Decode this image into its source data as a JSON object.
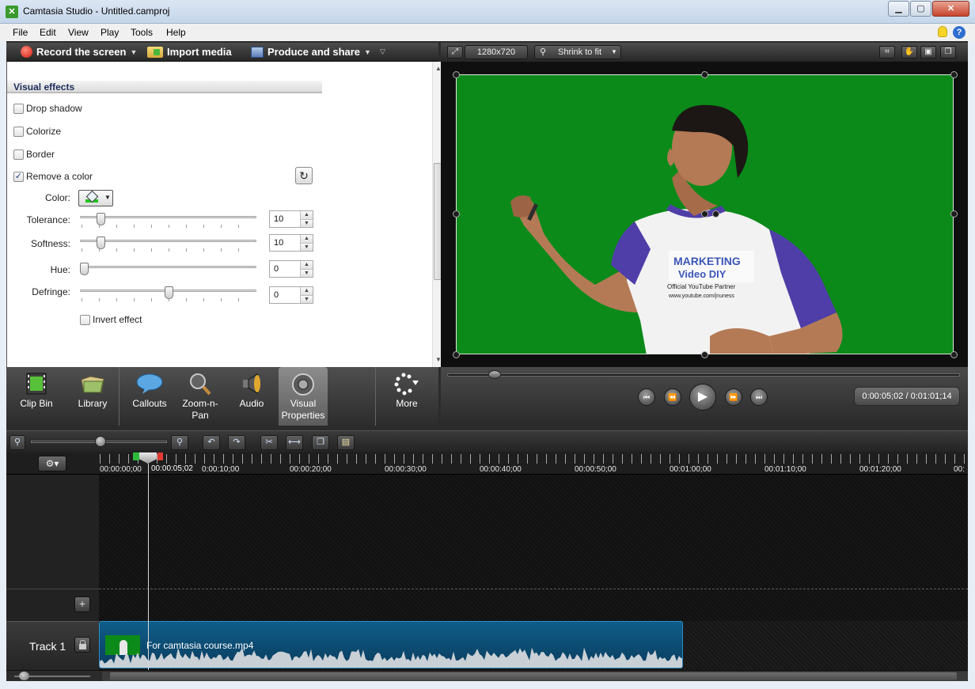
{
  "window": {
    "title": "Camtasia Studio - Untitled.camproj",
    "min_label": "▁",
    "max_label": "▢",
    "close_label": "✕"
  },
  "menu": [
    "File",
    "Edit",
    "View",
    "Play",
    "Tools",
    "Help"
  ],
  "toolbar": {
    "record_label": "Record the screen",
    "import_label": "Import media",
    "produce_label": "Produce and share"
  },
  "visual_effects": {
    "header": "Visual effects",
    "drop_shadow": "Drop shadow",
    "drop_shadow_checked": false,
    "colorize": "Colorize",
    "colorize_checked": false,
    "border": "Border",
    "border_checked": false,
    "remove_color": "Remove a color",
    "remove_color_checked": true,
    "color_label": "Color:",
    "key_color": "#1fc41f",
    "tolerance_label": "Tolerance:",
    "tolerance_value": "10",
    "softness_label": "Softness:",
    "softness_value": "10",
    "hue_label": "Hue:",
    "hue_value": "0",
    "defringe_label": "Defringe:",
    "defringe_value": "0",
    "invert_label": "Invert effect",
    "invert_checked": false
  },
  "tabs": [
    {
      "label": "Clip Bin",
      "icon": "film-strip-icon"
    },
    {
      "label": "Library",
      "icon": "library-folder-icon"
    },
    {
      "label": "Callouts",
      "icon": "speech-bubble-icon"
    },
    {
      "label": "Zoom-n-\nPan",
      "icon": "magnifier-icon"
    },
    {
      "label": "Audio",
      "icon": "speaker-icon"
    },
    {
      "label": "Visual\nProperties",
      "icon": "visual-properties-icon",
      "active": true
    },
    {
      "label": "More",
      "icon": "more-dots-icon"
    }
  ],
  "preview": {
    "dimensions": "1280x720",
    "fit_mode": "Shrink to fit",
    "background_color": "#0b8a1a",
    "shirt_text_1": "MARKETING",
    "shirt_text_2": "Video DIY",
    "shirt_text_3": "Official YouTube Partner",
    "shirt_text_4": "www.youtube.com/jnuness"
  },
  "playback": {
    "timecode": "0:00:05;02 / 0:01:01;14"
  },
  "timeline": {
    "playhead_time": "00:00:05;02",
    "ruler_labels": [
      "00:00:00;00",
      "0:00:10;00",
      "00:00:20;00",
      "00:00:30;00",
      "00:00:40;00",
      "00:00:50;00",
      "00:01:00;00",
      "00:01:10;00",
      "00:01:20;00",
      "00:"
    ],
    "track_label": "Track 1",
    "clip_name": "For camtasia course.mp4"
  }
}
